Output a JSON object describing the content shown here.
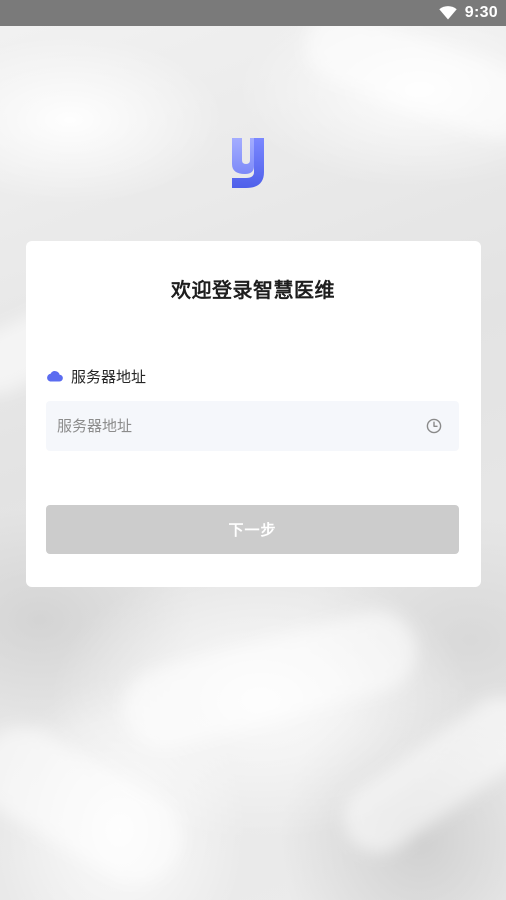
{
  "status_bar": {
    "time": "9:30",
    "wifi_icon": "wifi-icon"
  },
  "logo": {
    "icon": "app-logo-y",
    "colors": [
      "#8b97ff",
      "#5b6cf0"
    ]
  },
  "login": {
    "title": "欢迎登录智慧医维",
    "server_label": "服务器地址",
    "server_label_icon": "cloud-icon",
    "server_input": {
      "value": "",
      "placeholder": "服务器地址",
      "trailing_icon": "history-icon"
    },
    "next_button_label": "下一步"
  },
  "colors": {
    "accent": "#5b6cf0",
    "button_disabled": "#cccccc",
    "input_bg": "#f5f7fb"
  }
}
